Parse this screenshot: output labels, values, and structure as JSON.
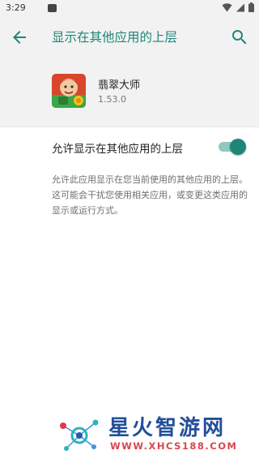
{
  "status_bar": {
    "time": "3:29"
  },
  "app_bar": {
    "title": "显示在其他应用的上层"
  },
  "app": {
    "name": "翡翠大师",
    "version": "1.53.0"
  },
  "setting": {
    "label": "允许显示在其他应用的上层",
    "enabled": true
  },
  "description": "允许此应用显示在您当前使用的其他应用的上层。这可能会干扰您使用相关应用，或变更这类应用的显示或运行方式。",
  "watermark": {
    "title": "星火智游网",
    "url": "WWW.XHCS188.COM"
  },
  "colors": {
    "accent": "#1e8577",
    "header_bg": "#f2f2f2",
    "toggle_track": "#8ec9bf"
  },
  "icons": [
    "back-arrow-icon",
    "search-icon",
    "wifi-icon",
    "signal-icon",
    "battery-icon"
  ]
}
